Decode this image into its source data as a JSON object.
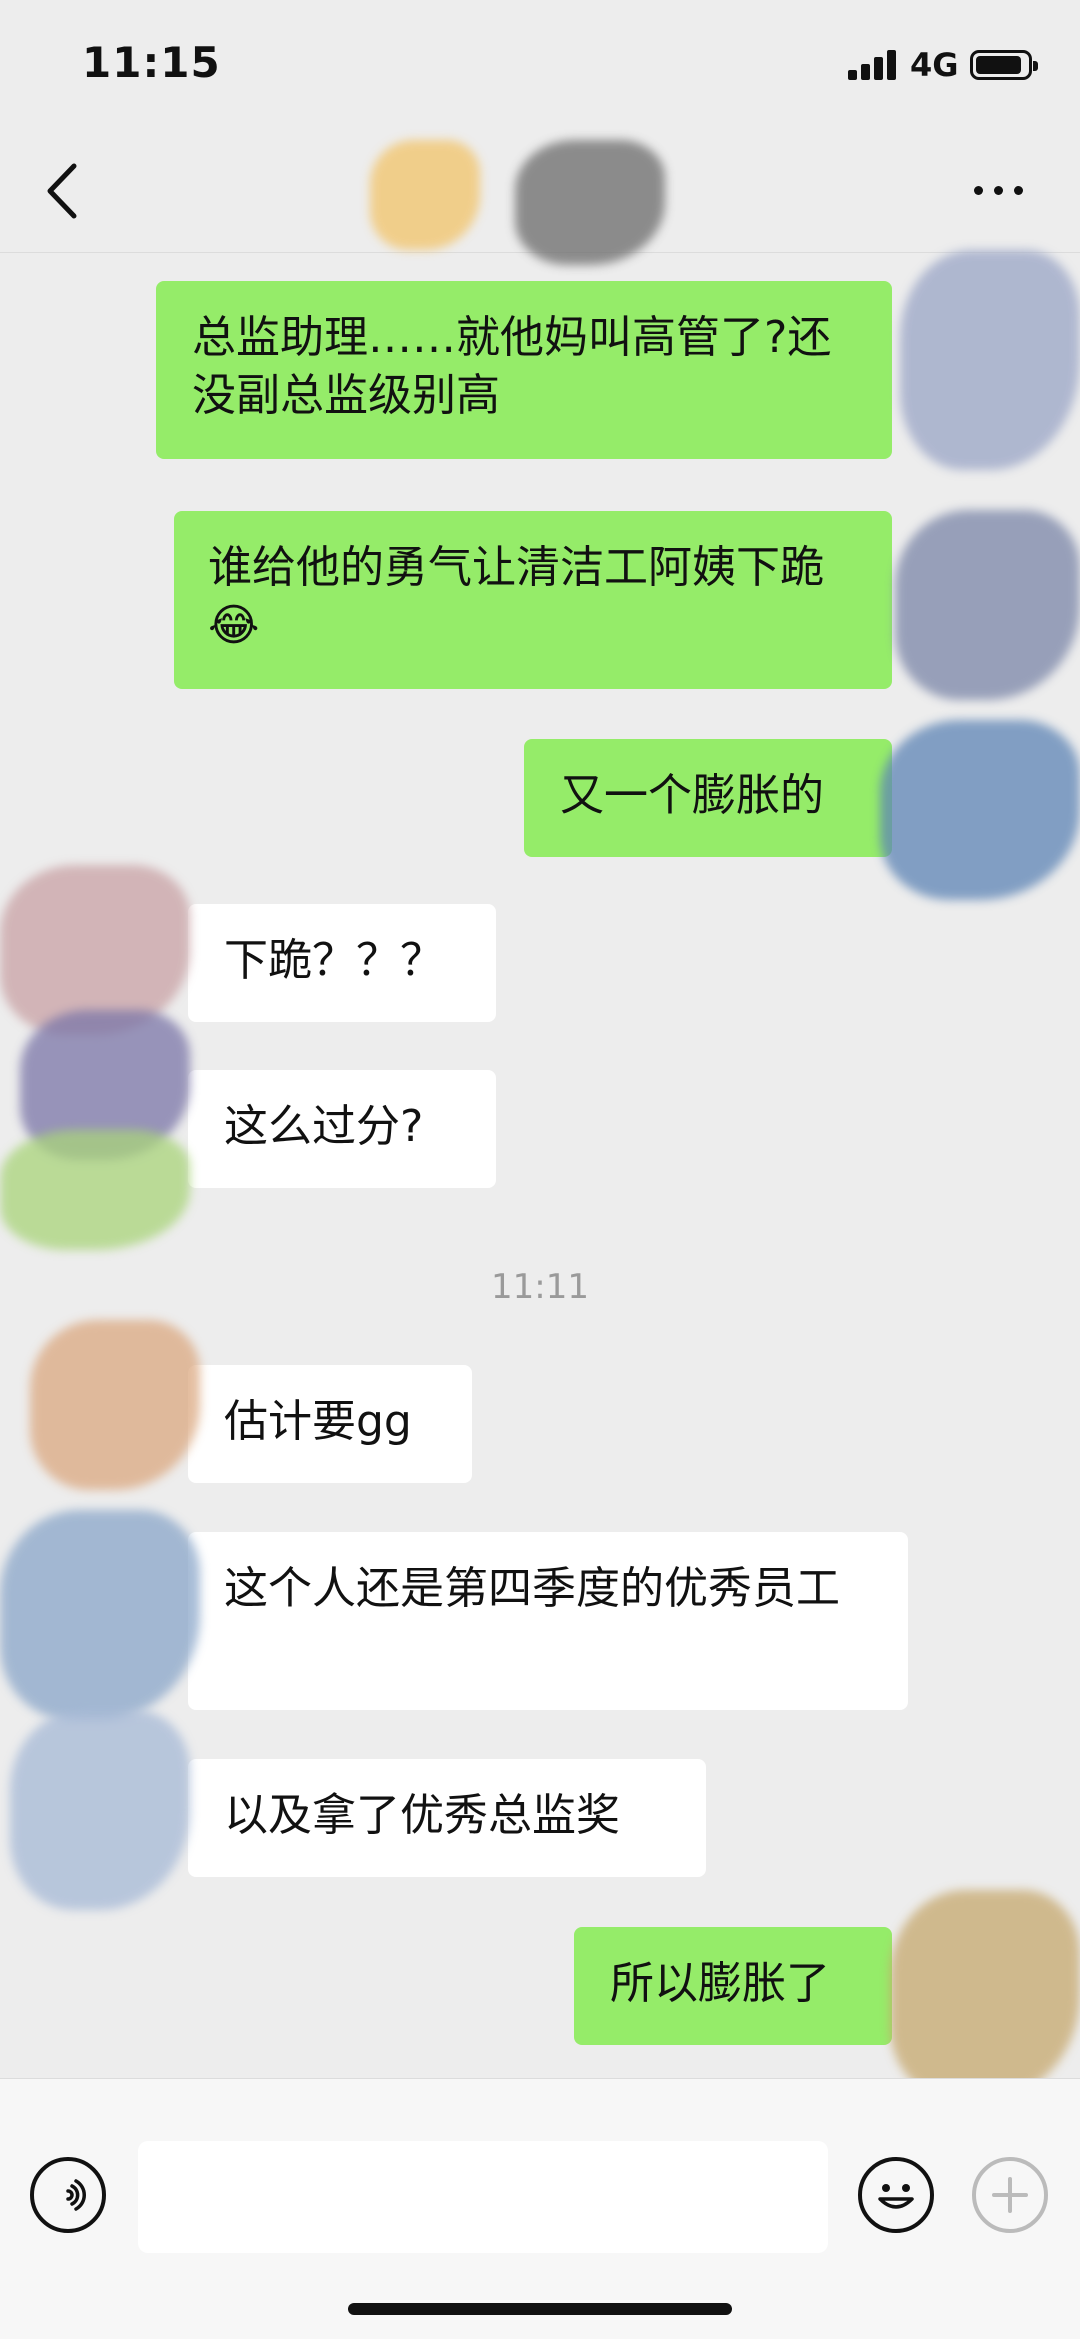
{
  "status_bar": {
    "time": "11:15",
    "network": "4G"
  },
  "nav": {
    "back_icon": "chevron-left-icon",
    "more_icon": "more-horizontal-icon"
  },
  "messages": [
    {
      "side": "sent",
      "text": "总监助理……就他妈叫高管了?还没副总监级别高"
    },
    {
      "side": "sent",
      "text": "谁给他的勇气让清洁工阿姨下跪😂"
    },
    {
      "side": "sent",
      "text": "又一个膨胀的"
    },
    {
      "side": "received",
      "text": "下跪？？？"
    },
    {
      "side": "received",
      "text": "这么过分?"
    },
    {
      "side": "received",
      "text": "估计要gg"
    },
    {
      "side": "received",
      "text": "这个人还是第四季度的优秀员工"
    },
    {
      "side": "received",
      "text": "以及拿了优秀总监奖"
    },
    {
      "side": "sent",
      "text": "所以膨胀了"
    }
  ],
  "timestamp": "11:11",
  "input_bar": {
    "voice_icon": "voice-icon",
    "input_value": "",
    "emoji_icon": "emoji-icon",
    "plus_icon": "plus-icon"
  },
  "colors": {
    "sent_bubble": "#95ec69",
    "received_bubble": "#ffffff",
    "background": "#ededed"
  }
}
